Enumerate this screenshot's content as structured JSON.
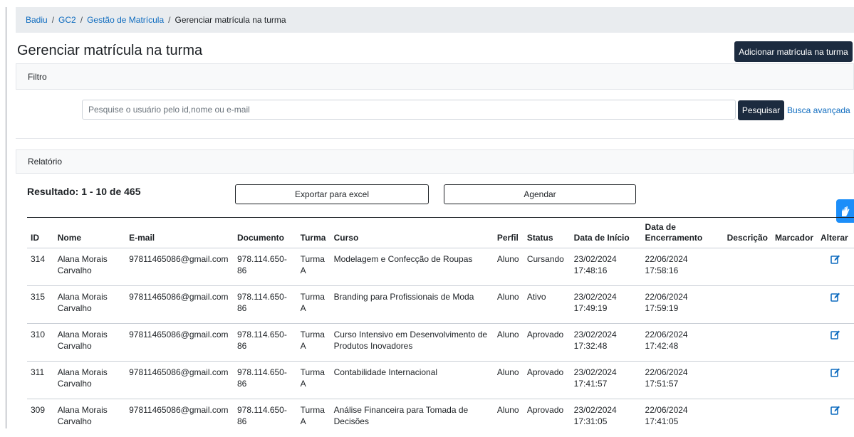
{
  "breadcrumb": {
    "items": [
      "Badiu",
      "GC2",
      "Gestão de Matrícula"
    ],
    "current": "Gerenciar matrícula na turma"
  },
  "header": {
    "title": "Gerenciar matrícula na turma",
    "add_button": "Adicionar matrícula na turma"
  },
  "filter": {
    "title": "Filtro",
    "search_placeholder": "Pesquise o usuário pelo id,nome ou e-mail",
    "search_button": "Pesquisar",
    "advanced_link": "Busca avançada"
  },
  "report": {
    "title": "Relatório",
    "result_text": "Resultado: 1 - 10 de 465",
    "export_button": "Exportar para excel",
    "schedule_button": "Agendar"
  },
  "table": {
    "headers": {
      "id": "ID",
      "nome": "Nome",
      "email": "E-mail",
      "documento": "Documento",
      "turma": "Turma",
      "curso": "Curso",
      "perfil": "Perfil",
      "status": "Status",
      "inicio": "Data de Início",
      "fim": "Data de Encerramento",
      "descricao": "Descrição",
      "marcador": "Marcador",
      "alterar": "Alterar"
    },
    "rows": [
      {
        "id": "314",
        "nome": "Alana Morais Carvalho",
        "email": "97811465086@gmail.com",
        "documento": "978.114.650-86",
        "turma": "Turma A",
        "curso": "Modelagem e Confecção de Roupas",
        "perfil": "Aluno",
        "status": "Cursando",
        "inicio": "23/02/2024 17:48:16",
        "fim": "22/06/2024 17:58:16",
        "descricao": "",
        "marcador": ""
      },
      {
        "id": "315",
        "nome": "Alana Morais Carvalho",
        "email": "97811465086@gmail.com",
        "documento": "978.114.650-86",
        "turma": "Turma A",
        "curso": "Branding para Profissionais de Moda",
        "perfil": "Aluno",
        "status": "Ativo",
        "inicio": "23/02/2024 17:49:19",
        "fim": "22/06/2024 17:59:19",
        "descricao": "",
        "marcador": ""
      },
      {
        "id": "310",
        "nome": "Alana Morais Carvalho",
        "email": "97811465086@gmail.com",
        "documento": "978.114.650-86",
        "turma": "Turma A",
        "curso": "Curso Intensivo em Desenvolvimento de Produtos Inovadores",
        "perfil": "Aluno",
        "status": "Aprovado",
        "inicio": "23/02/2024 17:32:48",
        "fim": "22/06/2024 17:42:48",
        "descricao": "",
        "marcador": ""
      },
      {
        "id": "311",
        "nome": "Alana Morais Carvalho",
        "email": "97811465086@gmail.com",
        "documento": "978.114.650-86",
        "turma": "Turma A",
        "curso": "Contabilidade Internacional",
        "perfil": "Aluno",
        "status": "Aprovado",
        "inicio": "23/02/2024 17:41:57",
        "fim": "22/06/2024 17:51:57",
        "descricao": "",
        "marcador": ""
      },
      {
        "id": "309",
        "nome": "Alana Morais Carvalho",
        "email": "97811465086@gmail.com",
        "documento": "978.114.650-86",
        "turma": "Turma A",
        "curso": "Análise Financeira para Tomada de Decisões",
        "perfil": "Aluno",
        "status": "Aprovado",
        "inicio": "23/02/2024 17:31:05",
        "fim": "22/06/2024 17:41:05",
        "descricao": "",
        "marcador": ""
      }
    ]
  },
  "icons": {
    "edit": "edit-icon",
    "accessibility": "sign-language-icon"
  },
  "colors": {
    "link": "#0f6cbf",
    "dark_button": "#1c2b3f",
    "widget": "#1c8ef9"
  }
}
